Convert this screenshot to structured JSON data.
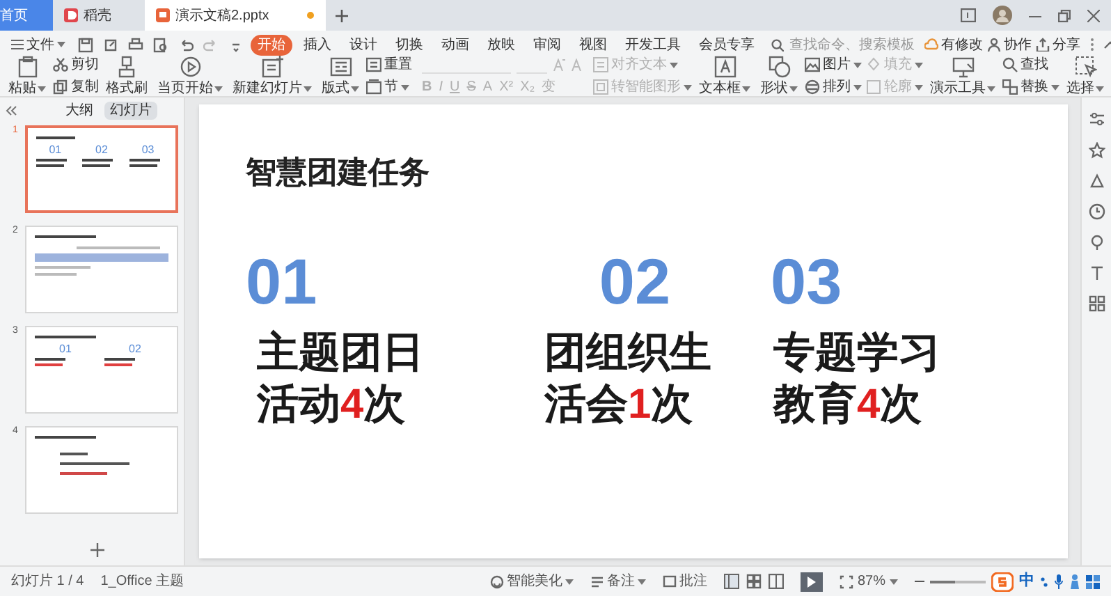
{
  "title_tabs": [
    {
      "label": "首页",
      "kind": "home",
      "selected": false
    },
    {
      "label": "稻壳",
      "kind": "docer",
      "selected": false
    },
    {
      "label": "演示文稿2.pptx",
      "kind": "file",
      "selected": true,
      "modified": true
    }
  ],
  "menu": {
    "file_label": "文件",
    "tabs": [
      {
        "label": "开始",
        "selected": true
      },
      {
        "label": "插入",
        "selected": false
      },
      {
        "label": "设计",
        "selected": false
      },
      {
        "label": "切换",
        "selected": false
      },
      {
        "label": "动画",
        "selected": false
      },
      {
        "label": "放映",
        "selected": false
      },
      {
        "label": "审阅",
        "selected": false
      },
      {
        "label": "视图",
        "selected": false
      },
      {
        "label": "开发工具",
        "selected": false
      },
      {
        "label": "会员专享",
        "selected": false
      }
    ],
    "search": {
      "placeholder": "查找命令、搜索模板"
    },
    "actions": [
      "有修改",
      "协作",
      "分享"
    ]
  },
  "ribbon": [
    {
      "kind": "large",
      "label": "粘贴",
      "dropdown": true
    },
    {
      "kind": "stack",
      "items": [
        {
          "label": "剪切",
          "dropdown": false,
          "disabled": false
        },
        {
          "label": "复制",
          "dropdown": false,
          "disabled": false
        }
      ]
    },
    {
      "kind": "large",
      "label": "格式刷",
      "dropdown": false
    },
    {
      "kind": "large",
      "label": "当页开始",
      "dropdown": true
    },
    {
      "kind": "large",
      "label": "新建幻灯片",
      "dropdown": true
    },
    {
      "kind": "large",
      "label": "版式",
      "dropdown": true
    },
    {
      "kind": "stack",
      "items": [
        {
          "label": "重置",
          "dropdown": false,
          "disabled": false
        },
        {
          "label": "节",
          "dropdown": true,
          "disabled": false
        }
      ]
    },
    {
      "kind": "font",
      "format_buttons": [
        "B",
        "I",
        "U",
        "S",
        "A",
        "X²",
        "X₂",
        "变"
      ]
    },
    {
      "kind": "stack",
      "items": [
        {
          "label": "对齐文本",
          "dropdown": true,
          "disabled": true
        },
        {
          "label": "转智能图形",
          "dropdown": true,
          "disabled": true
        }
      ]
    },
    {
      "kind": "large",
      "label": "文本框",
      "dropdown": true
    },
    {
      "kind": "large",
      "label": "形状",
      "dropdown": true
    },
    {
      "kind": "stack",
      "items": [
        {
          "label": "图片",
          "dropdown": true,
          "disabled": false
        },
        {
          "label": "排列",
          "dropdown": true,
          "disabled": false
        }
      ]
    },
    {
      "kind": "stack",
      "items": [
        {
          "label": "填充",
          "dropdown": true,
          "disabled": true
        },
        {
          "label": "轮廓",
          "dropdown": true,
          "disabled": true
        }
      ]
    },
    {
      "kind": "large",
      "label": "演示工具",
      "dropdown": true
    },
    {
      "kind": "stack",
      "items": [
        {
          "label": "查找",
          "dropdown": false,
          "disabled": false
        },
        {
          "label": "替换",
          "dropdown": true,
          "disabled": false
        }
      ]
    },
    {
      "kind": "large",
      "label": "选择",
      "dropdown": true
    }
  ],
  "side_panel": {
    "tabs": [
      {
        "label": "大纲",
        "selected": false
      },
      {
        "label": "幻灯片",
        "selected": true
      }
    ],
    "slides": [
      {
        "number": "1",
        "selected": true,
        "numbers": [
          "01",
          "02",
          "03"
        ]
      },
      {
        "number": "2",
        "selected": false
      },
      {
        "number": "3",
        "selected": false,
        "numbers": [
          "01",
          "02"
        ]
      },
      {
        "number": "4",
        "selected": false
      }
    ]
  },
  "slide": {
    "title": "智慧团建任务",
    "tasks": [
      {
        "number": "01",
        "lines": [
          [
            {
              "text": "主题团日",
              "accent": false
            }
          ],
          [
            {
              "text": "活动",
              "accent": false
            },
            {
              "text": "4",
              "accent": true
            },
            {
              "text": "次",
              "accent": false
            }
          ]
        ]
      },
      {
        "number": "02",
        "lines": [
          [
            {
              "text": "团组织生",
              "accent": false
            }
          ],
          [
            {
              "text": "活会",
              "accent": false
            },
            {
              "text": "1",
              "accent": true
            },
            {
              "text": "次",
              "accent": false
            }
          ]
        ]
      },
      {
        "number": "03",
        "lines": [
          [
            {
              "text": "专题学习",
              "accent": false
            }
          ],
          [
            {
              "text": "教育",
              "accent": false
            },
            {
              "text": "4",
              "accent": true
            },
            {
              "text": "次",
              "accent": false
            }
          ]
        ]
      }
    ]
  },
  "status_bar": {
    "slide_counter": "幻灯片 1 / 4",
    "theme": "1_Office 主题",
    "beautify": "智能美化",
    "notes": "备注",
    "comments": "批注",
    "zoom": "87%",
    "zoom_level": {
      "level": 0.45
    },
    "ime": "中"
  }
}
